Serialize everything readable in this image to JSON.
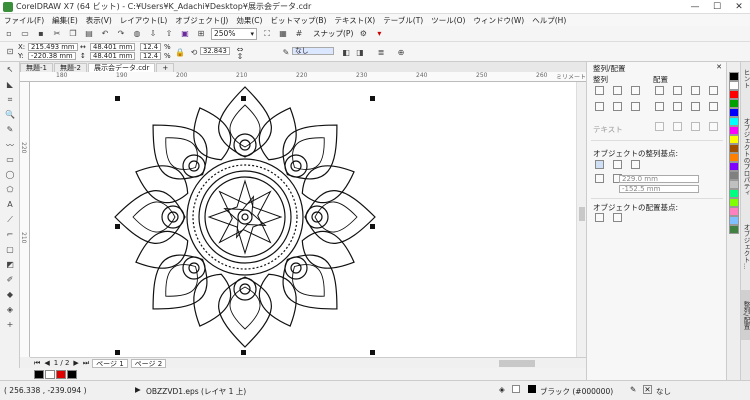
{
  "title": "CorelDRAW X7 (64 ビット) - C:¥Users¥K_Adachi¥Desktop¥展示会データ.cdr",
  "window_buttons": {
    "minimize": "—",
    "maximize": "☐",
    "close": "✕"
  },
  "menu": [
    "ファイル(F)",
    "編集(E)",
    "表示(V)",
    "レイアウト(L)",
    "オブジェクト(J)",
    "効果(C)",
    "ビットマップ(B)",
    "テキスト(X)",
    "テーブル(T)",
    "ツール(O)",
    "ウィンドウ(W)",
    "ヘルプ(H)"
  ],
  "toolbar": {
    "zoom": "250%",
    "snap_label": "スナップ(P)"
  },
  "properties": {
    "x": "215.493 mm",
    "y": "-220.38 mm",
    "width": "48.401 mm",
    "height": "48.401 mm",
    "scale_x": "12.4",
    "scale_y": "12.4",
    "pct": "%",
    "angle": "32.843",
    "outline": "なし"
  },
  "doc_tabs": [
    "無題-1",
    "無題-2",
    "展示会データ.cdr"
  ],
  "ruler": {
    "top": [
      "180",
      "190",
      "200",
      "210",
      "220",
      "230",
      "240",
      "250",
      "260"
    ],
    "unit": "ミリメートル",
    "left": [
      "220",
      "210"
    ]
  },
  "pager": {
    "page_count": "1 / 2",
    "pages": [
      "ページ 1",
      "ページ 2"
    ]
  },
  "palette": [
    "#000000",
    "#ffffff",
    "#e00000",
    "#000000"
  ],
  "status": {
    "coords": "( 256.338 , -239.094 )",
    "object": "OBZZVD1.eps (レイヤ 1 上)",
    "fill": "ブラック (#000000)",
    "outline": "なし"
  },
  "dock": {
    "title": "整列/配置",
    "align_label": "整列",
    "distribute_label": "配置",
    "text_label": "テキスト",
    "ref_label": "オブジェクトの整列基点:",
    "ref_x": "229.0 mm",
    "ref_y": "-152.5 mm",
    "dist_label": "オブジェクトの配置基点:"
  },
  "color_strip": [
    "#000000",
    "#ffffff",
    "#ff0000",
    "#00a000",
    "#0000ff",
    "#00ffff",
    "#ff00ff",
    "#ffff00",
    "#a05000",
    "#ff8000",
    "#8000ff",
    "#808080",
    "#c0c0c0",
    "#00ff80",
    "#80ff00",
    "#ff80c0",
    "#80c0ff",
    "#408040"
  ],
  "vtabs": [
    "ヒント",
    "オブジェクトのプロパティ",
    "オブジェクト...",
    "整列/配置"
  ]
}
